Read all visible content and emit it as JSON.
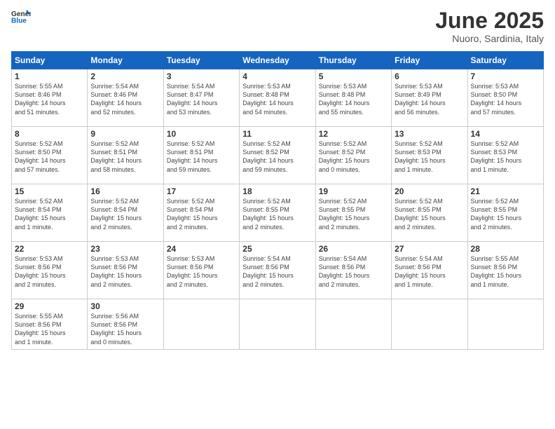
{
  "header": {
    "logo_general": "General",
    "logo_blue": "Blue",
    "title": "June 2025",
    "subtitle": "Nuoro, Sardinia, Italy"
  },
  "weekdays": [
    "Sunday",
    "Monday",
    "Tuesday",
    "Wednesday",
    "Thursday",
    "Friday",
    "Saturday"
  ],
  "weeks": [
    [
      {
        "day": "1",
        "info": "Sunrise: 5:55 AM\nSunset: 8:46 PM\nDaylight: 14 hours\nand 51 minutes."
      },
      {
        "day": "2",
        "info": "Sunrise: 5:54 AM\nSunset: 8:46 PM\nDaylight: 14 hours\nand 52 minutes."
      },
      {
        "day": "3",
        "info": "Sunrise: 5:54 AM\nSunset: 8:47 PM\nDaylight: 14 hours\nand 53 minutes."
      },
      {
        "day": "4",
        "info": "Sunrise: 5:53 AM\nSunset: 8:48 PM\nDaylight: 14 hours\nand 54 minutes."
      },
      {
        "day": "5",
        "info": "Sunrise: 5:53 AM\nSunset: 8:48 PM\nDaylight: 14 hours\nand 55 minutes."
      },
      {
        "day": "6",
        "info": "Sunrise: 5:53 AM\nSunset: 8:49 PM\nDaylight: 14 hours\nand 56 minutes."
      },
      {
        "day": "7",
        "info": "Sunrise: 5:53 AM\nSunset: 8:50 PM\nDaylight: 14 hours\nand 57 minutes."
      }
    ],
    [
      {
        "day": "8",
        "info": "Sunrise: 5:52 AM\nSunset: 8:50 PM\nDaylight: 14 hours\nand 57 minutes."
      },
      {
        "day": "9",
        "info": "Sunrise: 5:52 AM\nSunset: 8:51 PM\nDaylight: 14 hours\nand 58 minutes."
      },
      {
        "day": "10",
        "info": "Sunrise: 5:52 AM\nSunset: 8:51 PM\nDaylight: 14 hours\nand 59 minutes."
      },
      {
        "day": "11",
        "info": "Sunrise: 5:52 AM\nSunset: 8:52 PM\nDaylight: 14 hours\nand 59 minutes."
      },
      {
        "day": "12",
        "info": "Sunrise: 5:52 AM\nSunset: 8:52 PM\nDaylight: 15 hours\nand 0 minutes."
      },
      {
        "day": "13",
        "info": "Sunrise: 5:52 AM\nSunset: 8:53 PM\nDaylight: 15 hours\nand 1 minute."
      },
      {
        "day": "14",
        "info": "Sunrise: 5:52 AM\nSunset: 8:53 PM\nDaylight: 15 hours\nand 1 minute."
      }
    ],
    [
      {
        "day": "15",
        "info": "Sunrise: 5:52 AM\nSunset: 8:54 PM\nDaylight: 15 hours\nand 1 minute."
      },
      {
        "day": "16",
        "info": "Sunrise: 5:52 AM\nSunset: 8:54 PM\nDaylight: 15 hours\nand 2 minutes."
      },
      {
        "day": "17",
        "info": "Sunrise: 5:52 AM\nSunset: 8:54 PM\nDaylight: 15 hours\nand 2 minutes."
      },
      {
        "day": "18",
        "info": "Sunrise: 5:52 AM\nSunset: 8:55 PM\nDaylight: 15 hours\nand 2 minutes."
      },
      {
        "day": "19",
        "info": "Sunrise: 5:52 AM\nSunset: 8:55 PM\nDaylight: 15 hours\nand 2 minutes."
      },
      {
        "day": "20",
        "info": "Sunrise: 5:52 AM\nSunset: 8:55 PM\nDaylight: 15 hours\nand 2 minutes."
      },
      {
        "day": "21",
        "info": "Sunrise: 5:52 AM\nSunset: 8:55 PM\nDaylight: 15 hours\nand 2 minutes."
      }
    ],
    [
      {
        "day": "22",
        "info": "Sunrise: 5:53 AM\nSunset: 8:56 PM\nDaylight: 15 hours\nand 2 minutes."
      },
      {
        "day": "23",
        "info": "Sunrise: 5:53 AM\nSunset: 8:56 PM\nDaylight: 15 hours\nand 2 minutes."
      },
      {
        "day": "24",
        "info": "Sunrise: 5:53 AM\nSunset: 8:56 PM\nDaylight: 15 hours\nand 2 minutes."
      },
      {
        "day": "25",
        "info": "Sunrise: 5:54 AM\nSunset: 8:56 PM\nDaylight: 15 hours\nand 2 minutes."
      },
      {
        "day": "26",
        "info": "Sunrise: 5:54 AM\nSunset: 8:56 PM\nDaylight: 15 hours\nand 2 minutes."
      },
      {
        "day": "27",
        "info": "Sunrise: 5:54 AM\nSunset: 8:56 PM\nDaylight: 15 hours\nand 1 minute."
      },
      {
        "day": "28",
        "info": "Sunrise: 5:55 AM\nSunset: 8:56 PM\nDaylight: 15 hours\nand 1 minute."
      }
    ],
    [
      {
        "day": "29",
        "info": "Sunrise: 5:55 AM\nSunset: 8:56 PM\nDaylight: 15 hours\nand 1 minute."
      },
      {
        "day": "30",
        "info": "Sunrise: 5:56 AM\nSunset: 8:56 PM\nDaylight: 15 hours\nand 0 minutes."
      },
      {
        "day": "",
        "info": ""
      },
      {
        "day": "",
        "info": ""
      },
      {
        "day": "",
        "info": ""
      },
      {
        "day": "",
        "info": ""
      },
      {
        "day": "",
        "info": ""
      }
    ]
  ]
}
